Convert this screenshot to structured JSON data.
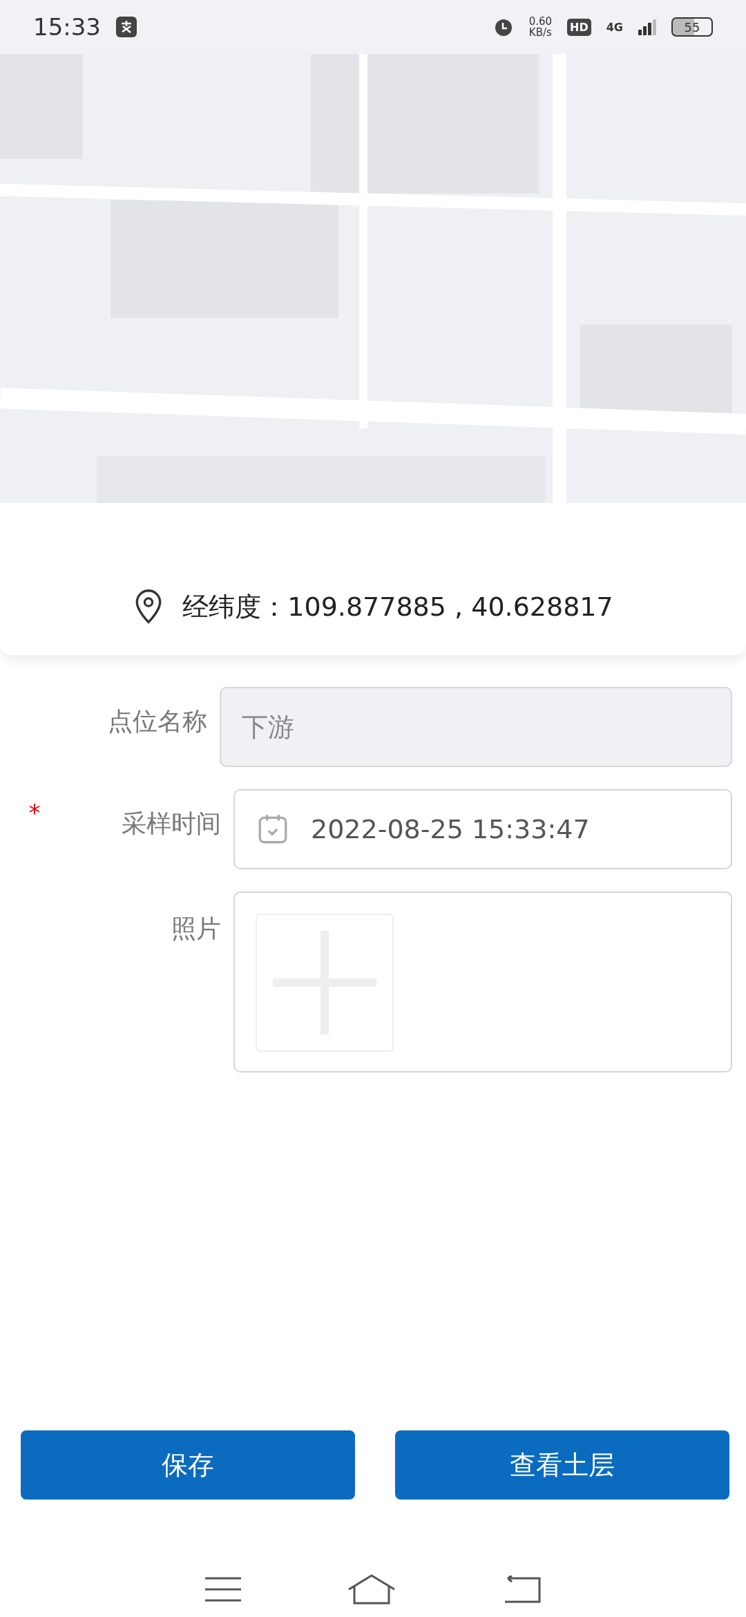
{
  "status_bar": {
    "time": "15:33",
    "speed_value": "0.60",
    "speed_unit": "KB/s",
    "hd": "HD",
    "network": "4G",
    "battery": "55"
  },
  "map": {
    "kind": "picture"
  },
  "location": {
    "label": "经纬度：109.877885 , 40.628817"
  },
  "form": [
    {
      "kind": "text",
      "label": "点位名称",
      "value": "下游",
      "disabled": true
    },
    {
      "kind": "datetime",
      "label": "采样时间",
      "value": "2022-08-25 15:33:47",
      "required_mark": "*",
      "disabled": false
    },
    {
      "label": "照片",
      "disabled": false
    }
  ],
  "buttons": [
    "保存",
    "查看土层"
  ]
}
